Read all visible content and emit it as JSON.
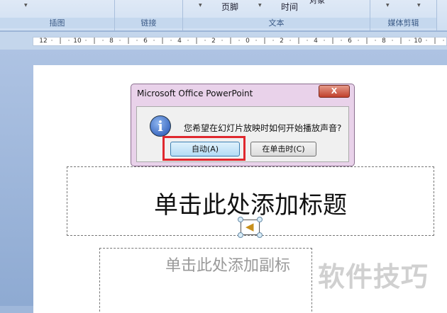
{
  "ribbon": {
    "groups": [
      {
        "label": "插图"
      },
      {
        "label": "链接"
      },
      {
        "label": "文本",
        "items": [
          "页脚",
          "时间",
          "对象"
        ]
      },
      {
        "label": "媒体剪辑"
      }
    ]
  },
  "ruler": {
    "ticks": [
      "12",
      "10",
      "8",
      "6",
      "4",
      "2",
      "0",
      "2",
      "4",
      "6",
      "8",
      "10"
    ]
  },
  "dialog": {
    "title": "Microsoft Office PowerPoint",
    "close": "X",
    "message": "您希望在幻灯片放映时如何开始播放声音?",
    "auto_button": "自动(A)",
    "click_button": "在单击时(C)"
  },
  "slide": {
    "title_placeholder": "单击此处添加标题",
    "subtitle_placeholder": "单击此处添加副标"
  },
  "watermark": "软件技巧"
}
